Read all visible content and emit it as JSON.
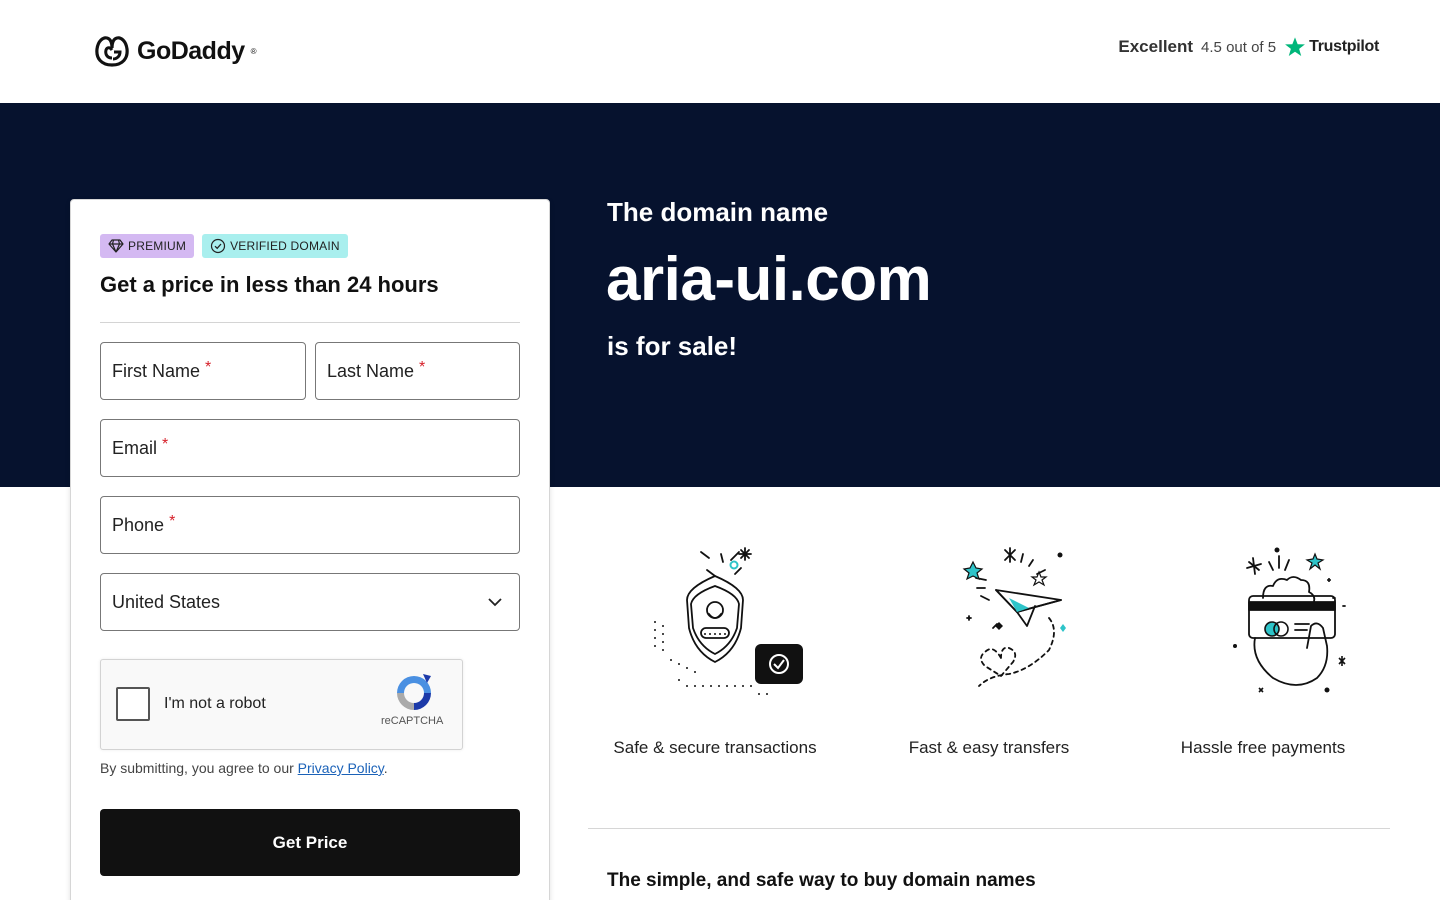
{
  "header": {
    "brand": "GoDaddy",
    "trademark": "®",
    "trust": {
      "rating_word": "Excellent",
      "score": "4.5 out of 5",
      "brand": "Trustpilot",
      "star_color": "#00b67a"
    }
  },
  "hero": {
    "pre": "The domain name",
    "domain": "aria-ui.com",
    "post": "is for sale!",
    "background": "#06122e"
  },
  "form": {
    "badges": {
      "premium": "PREMIUM",
      "verified": "VERIFIED DOMAIN"
    },
    "title": "Get a price in less than 24 hours",
    "fields": {
      "first_name": "First Name",
      "last_name": "Last Name",
      "email": "Email",
      "phone": "Phone",
      "required_marker": "*"
    },
    "country": {
      "selected": "United States"
    },
    "captcha": {
      "label": "I'm not a robot",
      "brand": "reCAPTCHA"
    },
    "consent": {
      "prefix": "By submitting, you agree to our ",
      "link": "Privacy Policy",
      "suffix": "."
    },
    "submit": "Get Price"
  },
  "features": [
    {
      "label": "Safe & secure transactions",
      "icon": "shield-icon"
    },
    {
      "label": "Fast & easy transfers",
      "icon": "paper-plane-icon"
    },
    {
      "label": "Hassle free payments",
      "icon": "credit-card-hand-icon"
    }
  ],
  "section": {
    "title": "The simple, and safe way to buy domain names"
  },
  "colors": {
    "accent_teal": "#2ec4c9",
    "premium_badge": "#d4b9f2",
    "verified_badge": "#a9efee"
  }
}
